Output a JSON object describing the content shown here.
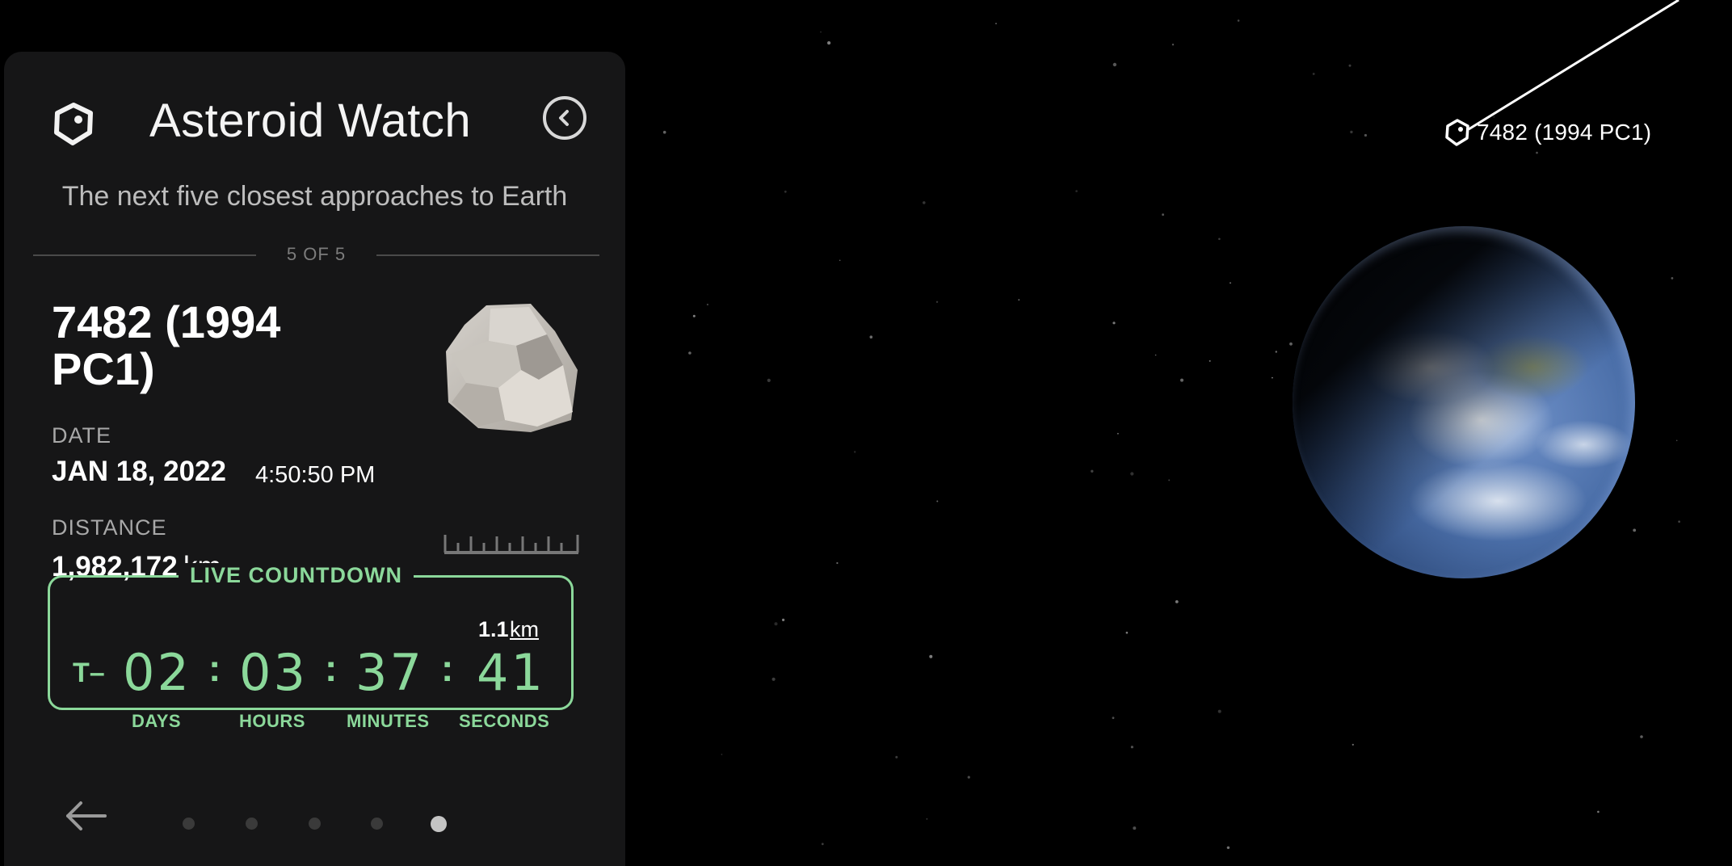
{
  "panel": {
    "title": "Asteroid Watch",
    "subtitle": "The next five closest approaches to Earth",
    "page_counter": "5 OF 5",
    "logo_icon": "asteroid-icon",
    "collapse_icon": "chevron-left-icon"
  },
  "asteroid": {
    "name": "7482 (1994 PC1)",
    "image_icon": "asteroid-rock",
    "date_label": "DATE",
    "date": "JAN 18, 2022",
    "time": "4:50:50 PM",
    "distance_label": "DISTANCE",
    "distance": "1,982,172",
    "distance_unit": "km",
    "size": "1.1",
    "size_unit": "km"
  },
  "countdown": {
    "title": "LIVE COUNTDOWN",
    "prefix": "T–",
    "days": "02",
    "hours": "03",
    "minutes": "37",
    "seconds": "41",
    "days_label": "DAYS",
    "hours_label": "HOURS",
    "minutes_label": "MINUTES",
    "seconds_label": "SECONDS"
  },
  "pager": {
    "prev_icon": "arrow-left-icon",
    "total": 5,
    "active": 5
  },
  "scene": {
    "marker_label": "7482 (1994 PC1)",
    "marker_icon": "asteroid-icon",
    "accent_color": "#8bd89a"
  }
}
